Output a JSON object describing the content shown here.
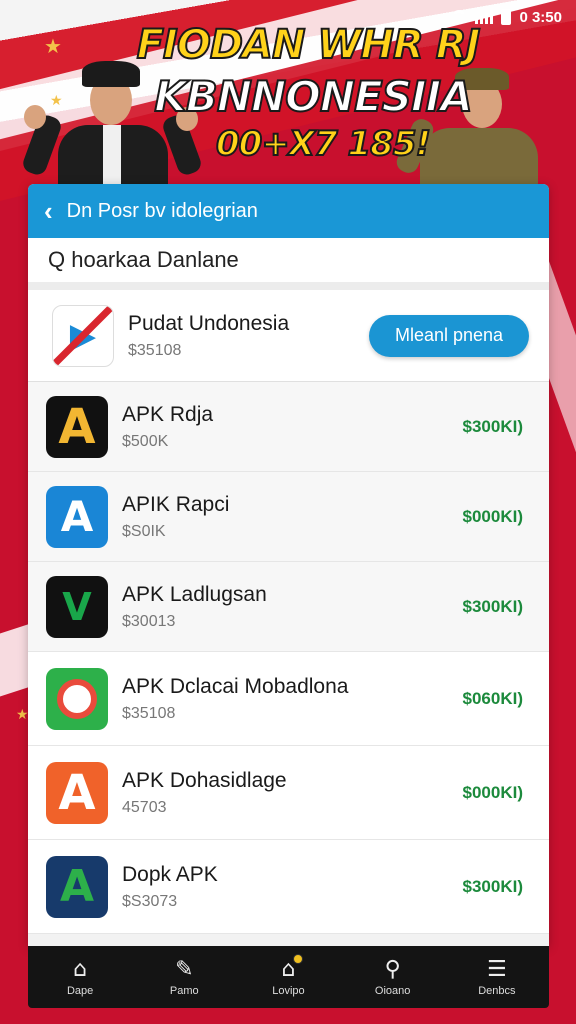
{
  "status_bar": {
    "time": "0 3:50"
  },
  "banner": {
    "line1": "FIODAN WHR RJ",
    "line2": "KBNNONESIIA",
    "line3": "00+X7 185!"
  },
  "appbar": {
    "title": "Dn Posr bv idolegrian"
  },
  "search": {
    "value": "Q hoarkaa Danlane"
  },
  "featured": {
    "name": "Pudat Undonesia",
    "sub": "$35108",
    "button_label": "Mleanl pnena",
    "icon": "crossed-app-icon"
  },
  "apps": [
    {
      "name": "APK Rdja",
      "sub": "$500K",
      "price": "$300KI)",
      "icon": "a-black-icon"
    },
    {
      "name": "APIK Rapci",
      "sub": "$S0IK",
      "price": "$000KI)",
      "icon": "a-blue-icon"
    },
    {
      "name": "APK Ladlugsan",
      "sub": "$30013",
      "price": "$300KI)",
      "icon": "v-black-icon"
    },
    {
      "name": "APK Dclacai Mobadlona",
      "sub": "$35108",
      "price": "$060KI)",
      "icon": "circle-green-icon"
    },
    {
      "name": "APK Dohasidlage",
      "sub": "45703",
      "price": "$000KI)",
      "icon": "a-orange-icon"
    },
    {
      "name": "Dopk APK",
      "sub": "$S3073",
      "price": "$300KI)",
      "icon": "a-navy-icon"
    }
  ],
  "nav": [
    {
      "label": "Dape",
      "icon": "home-icon"
    },
    {
      "label": "Pamo",
      "icon": "edit-icon"
    },
    {
      "label": "Lovipo",
      "icon": "house-badge-icon"
    },
    {
      "label": "Oioano",
      "icon": "search-icon"
    },
    {
      "label": "Denbcs",
      "icon": "menu-icon"
    }
  ],
  "colors": {
    "appbar": "#1a97d6",
    "button": "#1b95d3",
    "price": "#1c8a3c",
    "banner_red": "#c8102e",
    "headline_yellow": "#ffd21a"
  }
}
